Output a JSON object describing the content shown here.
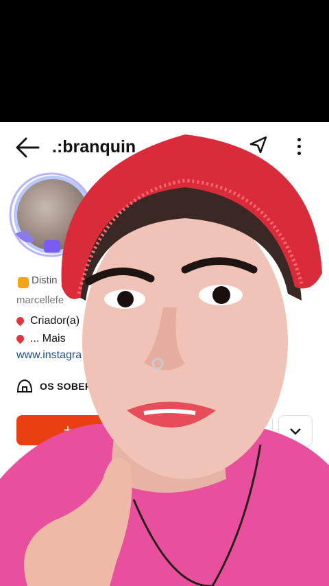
{
  "profile": {
    "back_icon": "arrow-left-icon",
    "username": ".:branquin",
    "share_icon": "share-icon",
    "more_icon": "more-vertical-icon",
    "distinction": "Distin",
    "handle": "marcellefe",
    "bio": [
      {
        "icon": "pin-icon",
        "text": "Criador(a)"
      },
      {
        "icon": "pin-icon",
        "text": "... Mais"
      }
    ],
    "link": "www.instagra",
    "group": "OS SOBERA",
    "follow_label": "+",
    "dropdown_icon": "chevron-down-icon"
  },
  "colors": {
    "follow": "#ea3f12",
    "link": "#1f4a85",
    "shirt": "#e84f9c",
    "cap": "#d92b3a"
  }
}
